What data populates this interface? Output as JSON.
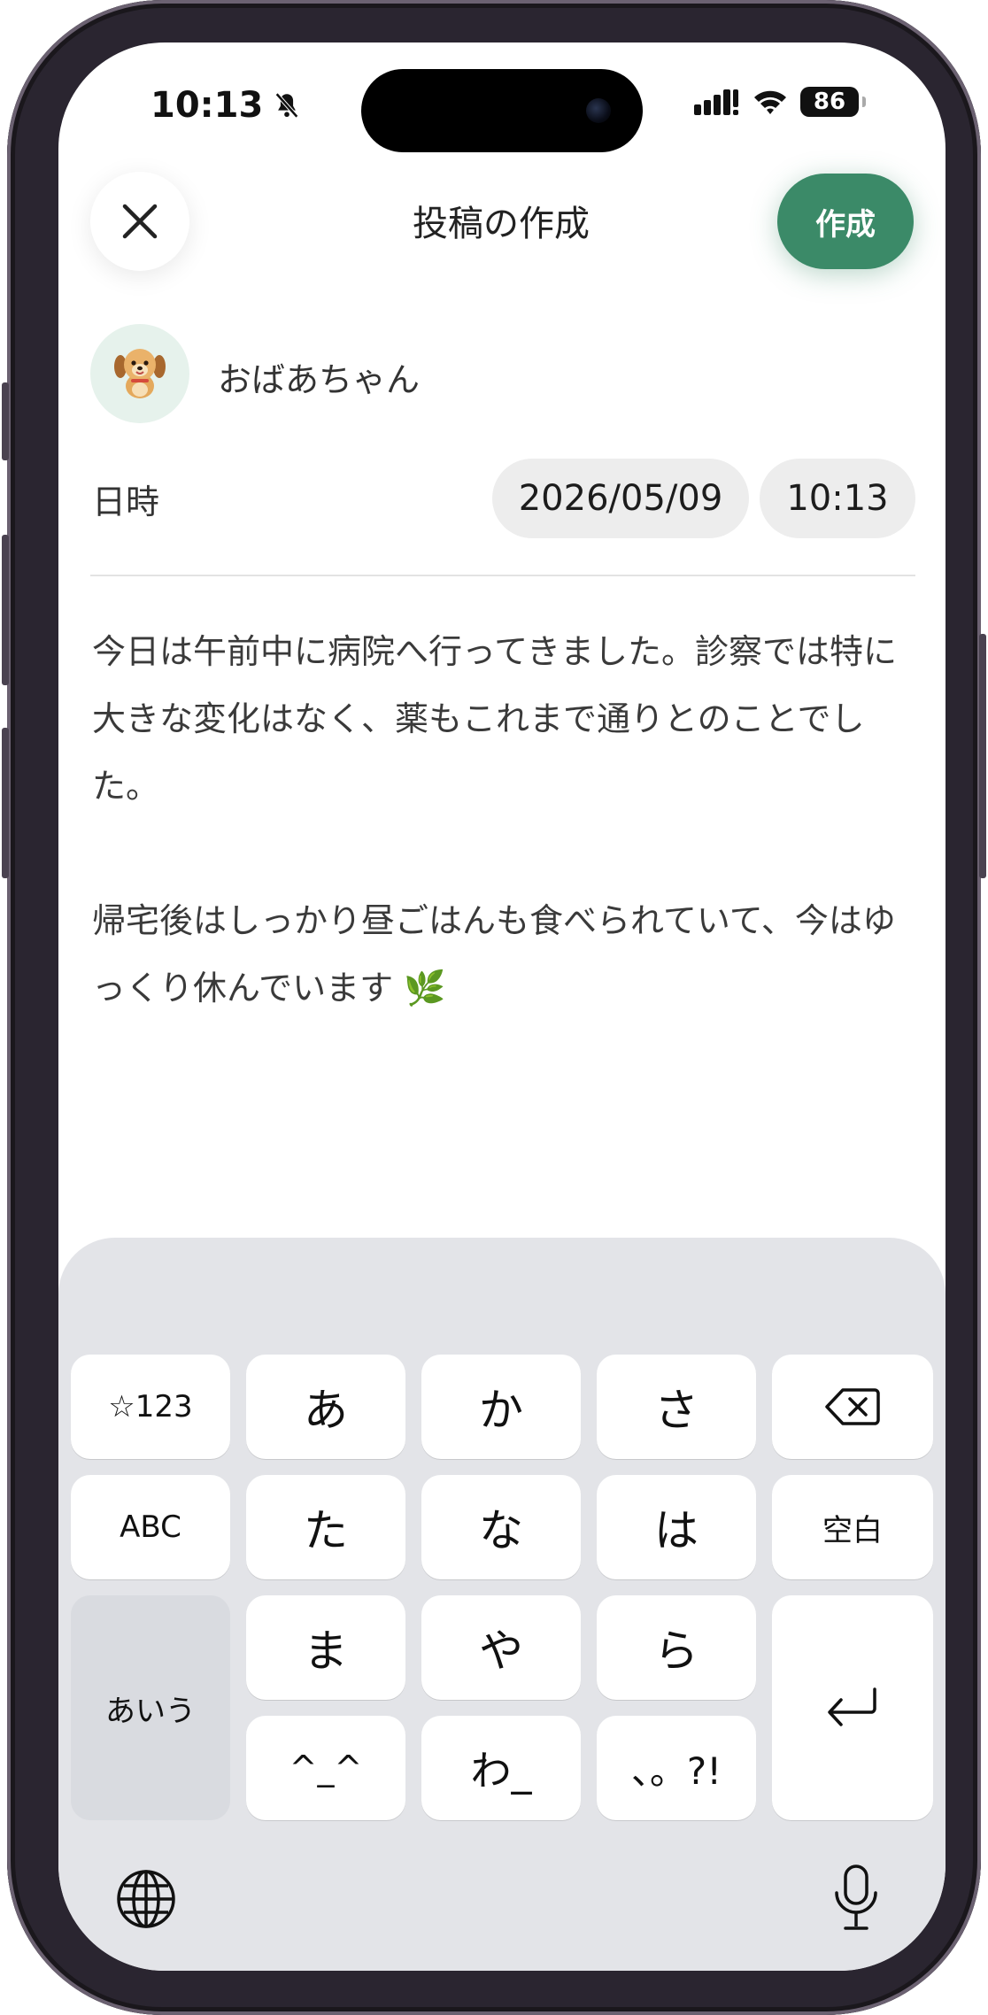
{
  "status_bar": {
    "time": "10:13",
    "battery": "86"
  },
  "header": {
    "title": "投稿の作成",
    "create_label": "作成"
  },
  "author": {
    "name": "おばあちゃん",
    "avatar": "dog-avatar"
  },
  "datetime": {
    "label": "日時",
    "date": "2026/05/09",
    "time": "10:13"
  },
  "post": {
    "paragraphs": [
      "今日は午前中に病院へ行ってきました。診察では特に大きな変化はなく、薬もこれまで通りとのことでした。",
      "帰宅後はしっかり昼ごはんも食べられていて、今はゆっくり休んでいます 🌿"
    ]
  },
  "keyboard": {
    "symbols_label": "☆123",
    "abc_label": "ABC",
    "hiragana_label": "あいう",
    "space_label": "空白",
    "keys": {
      "a": "あ",
      "ka": "か",
      "sa": "さ",
      "ta": "た",
      "na": "な",
      "ha": "は",
      "ma": "ま",
      "ya": "や",
      "ra": "ら",
      "kaomoji": "^_^",
      "wa": "わ_",
      "punct": "、。?!"
    },
    "icons": [
      "backspace-icon",
      "return-icon",
      "globe-icon",
      "microphone-icon"
    ]
  },
  "colors": {
    "accent": "#3b8a68",
    "avatar_bg": "#e6f2ec",
    "keyboard_bg": "#e3e4e8"
  }
}
